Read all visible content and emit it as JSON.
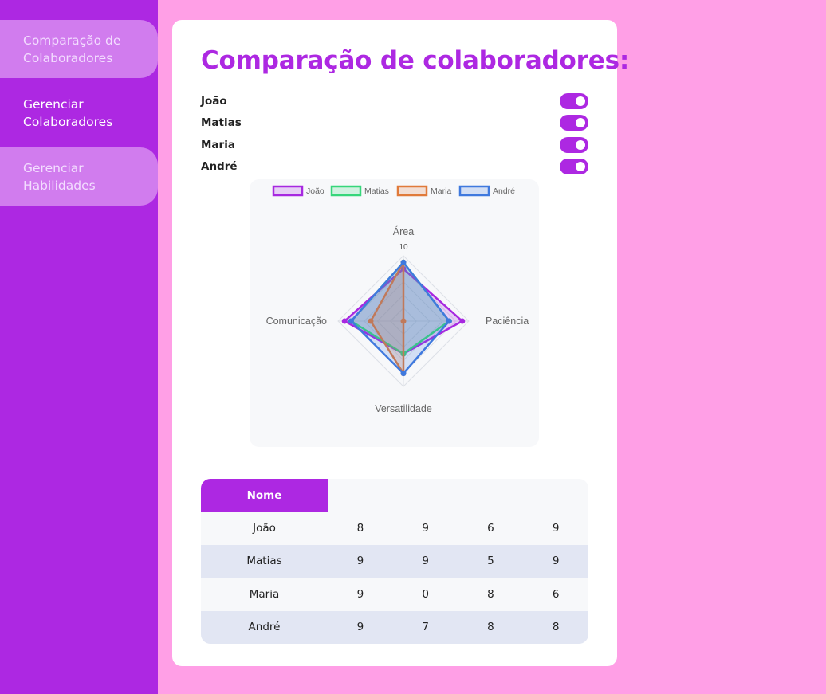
{
  "sidebar": {
    "items": [
      {
        "label": "Comparação de\nColaboradores",
        "active": false
      },
      {
        "label": "Gerenciar\nColaboradores",
        "active": true
      },
      {
        "label": "Gerenciar\nHabilidades",
        "active": false
      }
    ]
  },
  "main": {
    "title": "Comparação de colaboradores:",
    "toggles": [
      {
        "label": "João",
        "on": true
      },
      {
        "label": "Matias",
        "on": true
      },
      {
        "label": "Maria",
        "on": true
      },
      {
        "label": "André",
        "on": true
      }
    ]
  },
  "chart_data": {
    "type": "radar",
    "axes": [
      "Área",
      "Paciência",
      "Versatilidade",
      "Comunicação"
    ],
    "scale_max": 10,
    "tick_label": "10",
    "legend_position": "top",
    "series": [
      {
        "name": "João",
        "color": "#a728e0",
        "values": [
          8,
          9,
          5,
          9
        ]
      },
      {
        "name": "Matias",
        "color": "#36d67a",
        "values": [
          9,
          7,
          5,
          8
        ]
      },
      {
        "name": "Maria",
        "color": "#e07a3a",
        "values": [
          9,
          0,
          8,
          5
        ]
      },
      {
        "name": "André",
        "color": "#3f79de",
        "values": [
          9,
          7,
          8,
          8
        ]
      }
    ]
  },
  "table": {
    "header": "Nome",
    "rows": [
      [
        "João",
        "8",
        "9",
        "6",
        "9"
      ],
      [
        "Matias",
        "9",
        "9",
        "5",
        "9"
      ],
      [
        "Maria",
        "9",
        "0",
        "8",
        "6"
      ],
      [
        "André",
        "9",
        "7",
        "8",
        "8"
      ]
    ]
  },
  "colors": {
    "background": "#ff9fe6",
    "accent": "#ad28e2",
    "card": "#ffffff"
  }
}
